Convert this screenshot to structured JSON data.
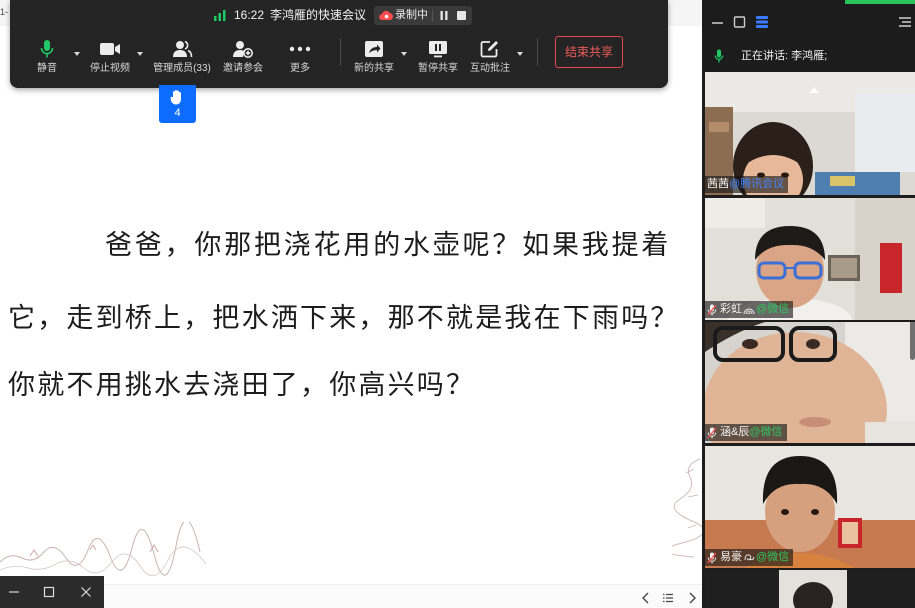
{
  "corner_text": "1-",
  "toolbar": {
    "time": "16:22",
    "meeting_title": "李鸿雁的快速会议",
    "recording_label": "录制中",
    "buttons": {
      "mute": "静音",
      "stop_video": "停止视频",
      "manage_members": "管理成员(33)",
      "invite": "邀请参会",
      "more": "更多",
      "new_share": "新的共享",
      "pause_share": "暂停共享",
      "annotate": "互动批注",
      "end_share": "结束共享"
    },
    "raised_hands_count": "4"
  },
  "document": {
    "lines": [
      "爸爸，你那把浇花用的水壶呢？如果我提着",
      "它，走到桥上，把水洒下来，那不就是我在下雨吗？",
      "你就不用挑水去浇田了，你高兴吗？"
    ]
  },
  "side_panel": {
    "speaking": "正在讲话: 李鸿雁;",
    "participants": [
      {
        "name": "茜茜",
        "source": "@腾讯会议",
        "muted": false
      },
      {
        "name": "彩虹",
        "source": "@微信",
        "muted": true
      },
      {
        "name": "涵&辰",
        "source": "@微信",
        "muted": true
      },
      {
        "name": "易豪",
        "source": "@微信",
        "muted": true
      }
    ]
  },
  "icons": {
    "signal": "signal-bars-icon",
    "record": "cloud-record-icon",
    "mute": "microphone-icon",
    "video": "camera-icon",
    "members": "members-icon",
    "invite": "add-person-icon",
    "more": "more-dots-icon",
    "new_share": "share-screen-icon",
    "pause_share": "pause-screen-icon",
    "annotate": "annotate-pencil-icon",
    "hand": "raised-hand-icon",
    "nav_prev": "chevron-left-icon",
    "nav_list": "list-icon",
    "nav_next": "chevron-right-icon"
  },
  "colors": {
    "toolbar_bg": "#242424",
    "mic_green": "#1fc965",
    "hand_blue": "#0b6cff",
    "end_share_red": "#e5484d",
    "tencent_blue": "#3f86ff",
    "wechat_green": "#2fc65e",
    "panel_bg": "#1c1c1c"
  }
}
